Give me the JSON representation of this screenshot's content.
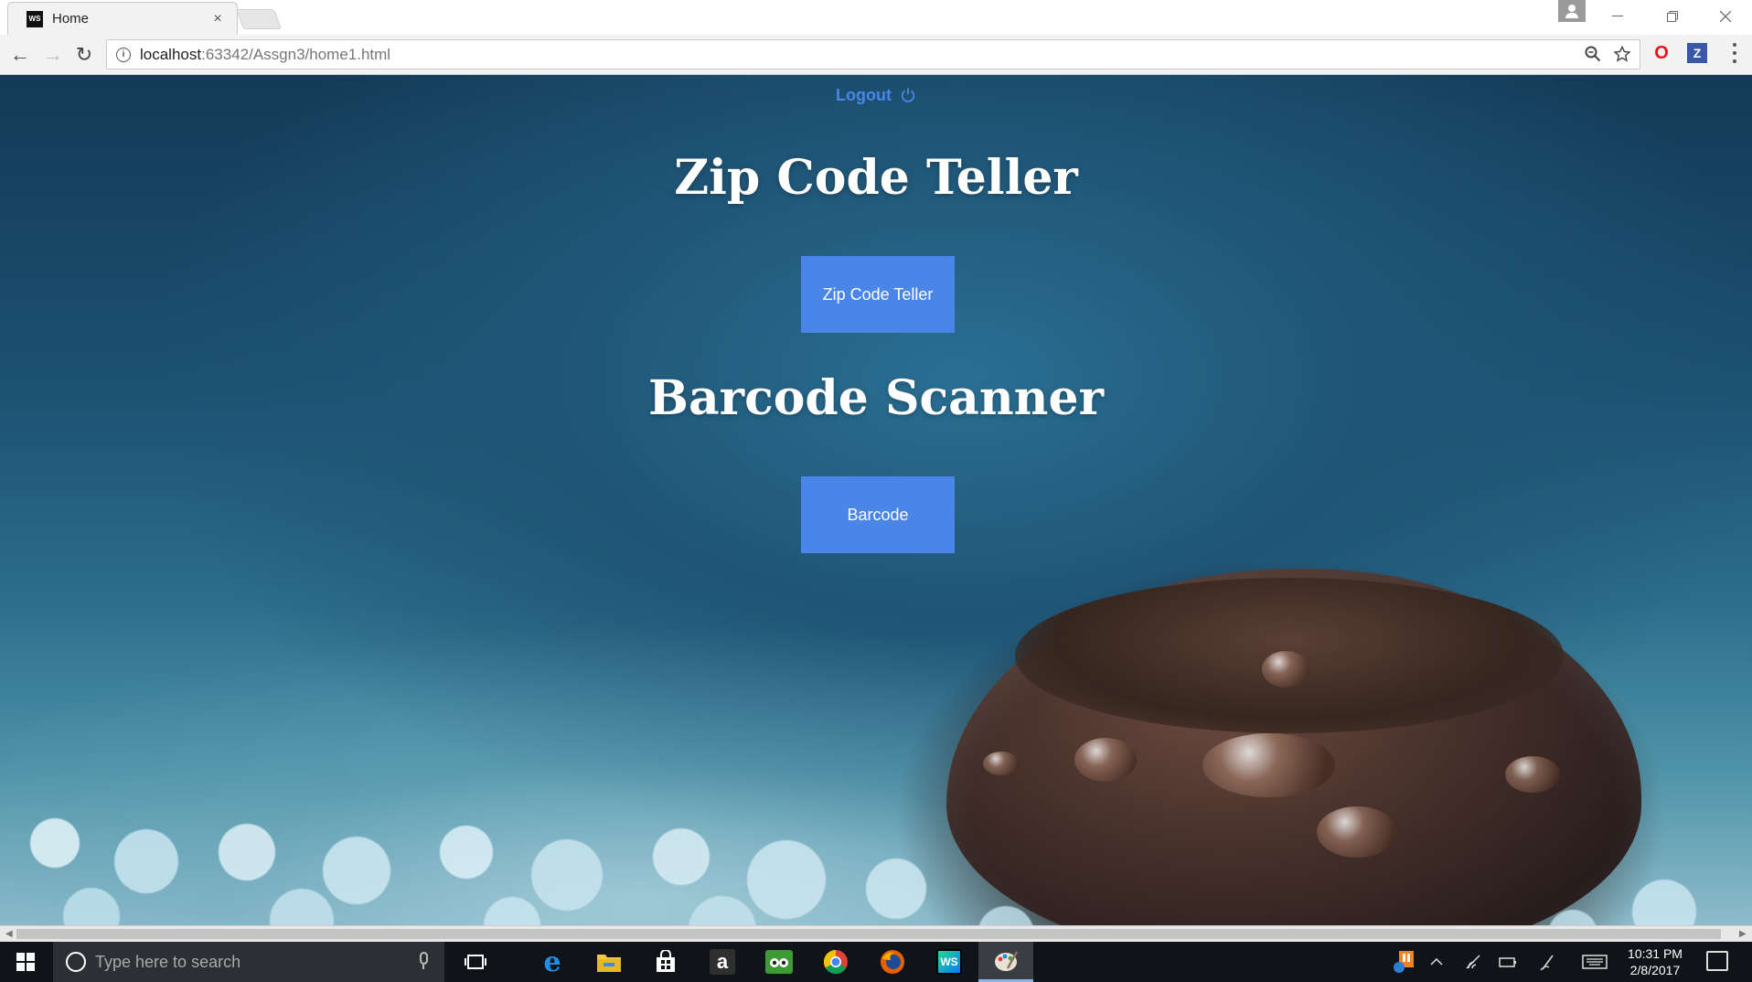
{
  "browser": {
    "tab": {
      "favicon": "WS",
      "title": "Home",
      "close": "×"
    },
    "url": {
      "host": "localhost",
      "path": ":63342/Assgn3/home1.html"
    },
    "nav": {
      "back": "←",
      "forward": "→",
      "reload": "↻"
    },
    "icons": [
      "info-icon",
      "zoom-icon",
      "star-icon",
      "opera-icon",
      "z-extension-icon",
      "menu-icon"
    ],
    "ext_opera": "O",
    "ext_z": "Z"
  },
  "page": {
    "logout_label": "Logout",
    "heading_zip": "Zip Code Teller",
    "button_zip": "Zip Code Teller",
    "heading_barcode": "Barcode Scanner",
    "button_barcode": "Barcode",
    "accent_color": "#4a86e8"
  },
  "taskbar": {
    "search_placeholder": "Type here to search",
    "apps": [
      "task-view",
      "edge",
      "file-explorer",
      "store",
      "amazon",
      "tripadvisor",
      "chrome",
      "firefox",
      "webstorm",
      "paint"
    ],
    "amazon_glyph": "a",
    "webstorm_glyph": "WS",
    "clock_time": "10:31 PM",
    "clock_date": "2/8/2017"
  }
}
